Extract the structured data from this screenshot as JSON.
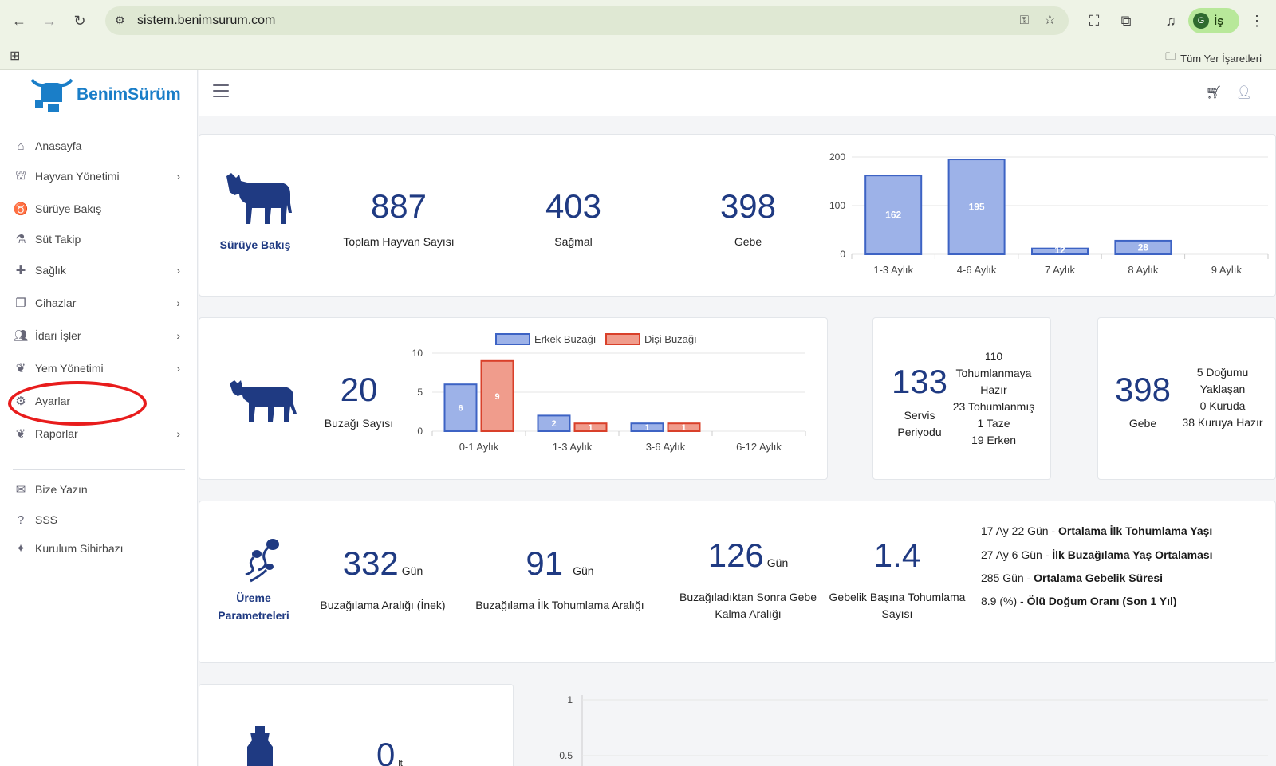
{
  "browser": {
    "url": "sistem.benimsurum.com",
    "profile_initial": "G",
    "profile_label": "İş",
    "bookmarks_label": "Tüm Yer İşaretleri"
  },
  "app": {
    "logo_text": "BenimSürüm"
  },
  "sidebar": {
    "items": [
      {
        "label": "Anasayfa",
        "icon": "home-icon",
        "has_children": false
      },
      {
        "label": "Hayvan Yönetimi",
        "icon": "barn-icon",
        "has_children": true
      },
      {
        "label": "Sürüye Bakış",
        "icon": "cow-head-icon",
        "has_children": false
      },
      {
        "label": "Süt Takip",
        "icon": "flask-icon",
        "has_children": false
      },
      {
        "label": "Sağlık",
        "icon": "health-hand-icon",
        "has_children": true
      },
      {
        "label": "Cihazlar",
        "icon": "devices-icon",
        "has_children": true
      },
      {
        "label": "İdari İşler",
        "icon": "admin-user-icon",
        "has_children": true
      },
      {
        "label": "Yem Yönetimi",
        "icon": "feed-icon",
        "has_children": true
      },
      {
        "label": "Ayarlar",
        "icon": "gear-icon",
        "has_children": false
      },
      {
        "label": "Raporlar",
        "icon": "report-icon",
        "has_children": true
      }
    ],
    "bottom_items": [
      {
        "label": "Bize Yazın",
        "icon": "contact-icon"
      },
      {
        "label": "SSS",
        "icon": "question-icon"
      },
      {
        "label": "Kurulum Sihirbazı",
        "icon": "wand-icon"
      }
    ]
  },
  "herd_overview": {
    "title": "Sürüye Bakış",
    "stats": [
      {
        "value": "887",
        "label": "Toplam Hayvan Sayısı"
      },
      {
        "value": "403",
        "label": "Sağmal"
      },
      {
        "value": "398",
        "label": "Gebe"
      }
    ]
  },
  "calves": {
    "value": "20",
    "label": "Buzağı Sayısı"
  },
  "service": {
    "value": "133",
    "label": "Servis Periyodu",
    "details": [
      "110",
      "Tohumlanmaya",
      "Hazır",
      "23 Tohumlanmış",
      "1 Taze",
      "19 Erken"
    ]
  },
  "pregnant": {
    "value": "398",
    "label": "Gebe",
    "details": [
      "5 Doğumu",
      "Yaklaşan",
      "0 Kuruda",
      "38 Kuruya Hazır"
    ]
  },
  "reproduction": {
    "title_line1": "Üreme",
    "title_line2": "Parametreleri",
    "stats": [
      {
        "value": "332",
        "unit": "Gün",
        "label": "Buzağılama Aralığı (İnek)"
      },
      {
        "value": "91",
        "unit": "Gün",
        "label": "Buzağılama İlk Tohumlama Aralığı"
      },
      {
        "value": "126",
        "unit": "Gün",
        "label_line1": "Buzağıladıktan Sonra Gebe",
        "label_line2": "Kalma Aralığı"
      },
      {
        "value": "1.4",
        "unit": "",
        "label_line1": "Gebelik Başına Tohumlama",
        "label_line2": "Sayısı"
      }
    ],
    "lines": [
      {
        "value": "17 Ay 22 Gün",
        "label": "Ortalama İlk Tohumlama Yaşı"
      },
      {
        "value": "27 Ay 6 Gün",
        "label": "İlk Buzağılama Yaş Ortalaması"
      },
      {
        "value": "285 Gün",
        "label": "Ortalama Gebelik Süresi"
      },
      {
        "value": "8.9 (%)",
        "label": "Ölü Doğum Oranı (Son 1 Yıl)"
      }
    ]
  },
  "milk": {
    "value": "0",
    "unit": "lt"
  },
  "colors": {
    "accent": "#1f3a82",
    "bar_blue_fill": "#9db2e8",
    "bar_blue_stroke": "#3d63c4",
    "bar_red_fill": "#f09c8c",
    "bar_red_stroke": "#d9402a",
    "highlight_ring": "#e81c1c"
  },
  "chart_data": [
    {
      "type": "bar",
      "categories": [
        "1-3 Aylık",
        "4-6 Aylık",
        "7 Aylık",
        "8 Aylık",
        "9 Aylık"
      ],
      "values": [
        162,
        195,
        12,
        28,
        0
      ],
      "yticks": [
        0,
        100,
        200
      ],
      "ylim": [
        0,
        200
      ]
    },
    {
      "type": "bar",
      "categories": [
        "0-1 Aylık",
        "1-3 Aylık",
        "3-6 Aylık",
        "6-12 Aylık"
      ],
      "series": [
        {
          "name": "Erkek Buzağı",
          "values": [
            6,
            2,
            1,
            0
          ]
        },
        {
          "name": "Dişi Buzağı",
          "values": [
            9,
            1,
            1,
            0
          ]
        }
      ],
      "yticks": [
        0,
        5,
        10
      ],
      "ylim": [
        0,
        10
      ],
      "legend": "top"
    },
    {
      "type": "line",
      "yticks": [
        0.5,
        1
      ],
      "ylim": [
        0,
        1
      ]
    }
  ]
}
